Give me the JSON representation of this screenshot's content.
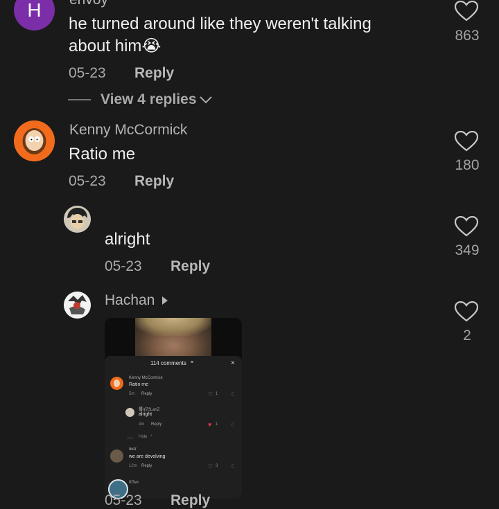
{
  "comments": [
    {
      "username": "envoy",
      "avatar_letter": "H",
      "avatar_color": "#7b2ea8",
      "text": "he turned around like they weren't talking about him😭",
      "date": "05-23",
      "reply_label": "Reply",
      "likes": "863",
      "view_replies": "View 4 replies"
    },
    {
      "username": "Kenny McCormick",
      "avatar_color": "#f26b1d",
      "text": "Ratio me",
      "date": "05-23",
      "reply_label": "Reply",
      "likes": "180"
    }
  ],
  "replies": [
    {
      "text": "alright",
      "date": "05-23",
      "reply_label": "Reply",
      "likes": "349"
    },
    {
      "username": "Hachan",
      "likes": "2",
      "date": "05-23",
      "reply_label": "Reply"
    }
  ],
  "embedded_screenshot": {
    "header": "114 comments",
    "items": [
      {
        "user": "Kenny McCormick",
        "text": "Ratio me",
        "time": "5m",
        "reply": "Reply",
        "likes": "1"
      },
      {
        "user": "璽ꀷ卍LanZ",
        "text": "alright",
        "time": "4m",
        "reply": "Reply",
        "likes": "1"
      },
      {
        "hide": "Hide"
      },
      {
        "user": "ʀɴɪғ",
        "text": "we are devolving",
        "time": "12m",
        "reply": "Reply",
        "likes": "3"
      },
      {
        "user": "0Πve"
      }
    ]
  }
}
